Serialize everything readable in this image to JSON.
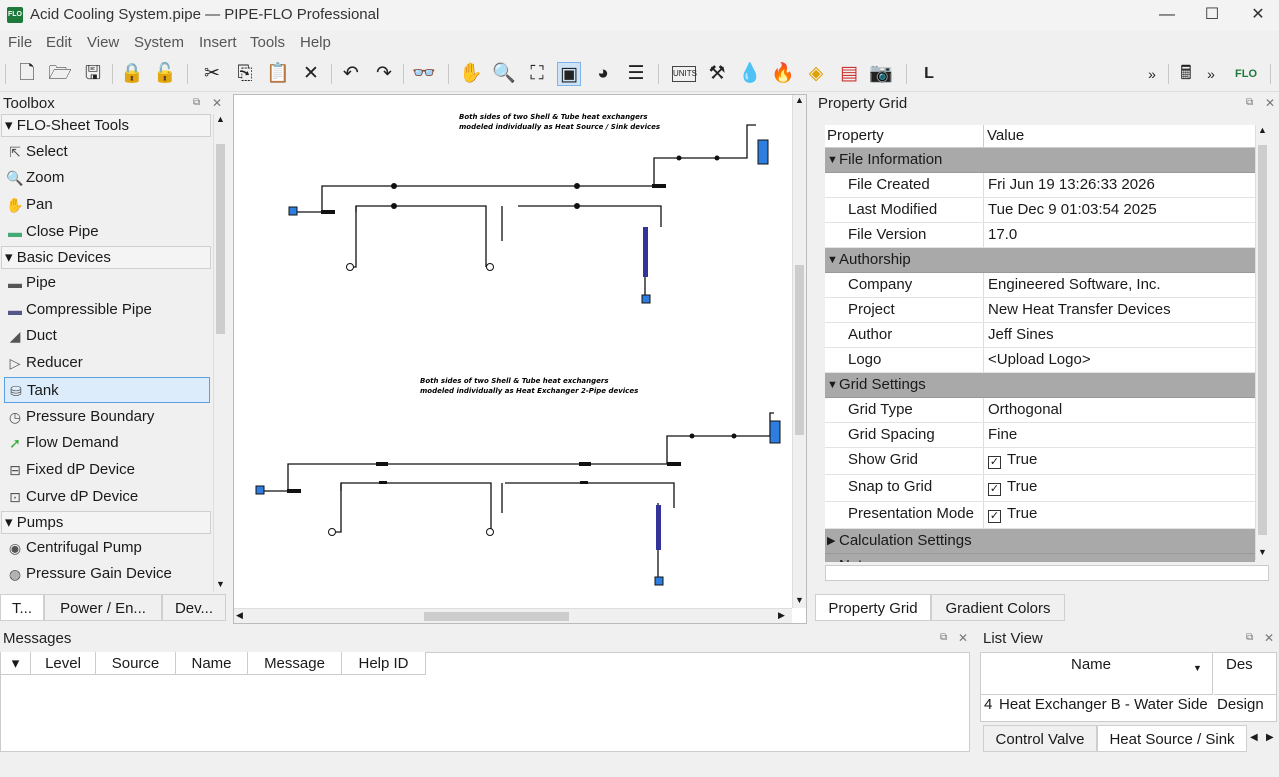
{
  "window": {
    "title": "Acid Cooling System.pipe — PIPE-FLO Professional",
    "logo_text": "FLO",
    "minimize": "—",
    "maximize": "☐",
    "close": "✕"
  },
  "menu": [
    "File",
    "Edit",
    "View",
    "System",
    "Insert",
    "Tools",
    "Help"
  ],
  "toolbar": {
    "overflow_1": "»",
    "overflow_2": "»",
    "units_label": "UNITS"
  },
  "toolbox": {
    "title": "Toolbox",
    "sections": {
      "flo_sheet": "FLO-Sheet Tools",
      "basic": "Basic Devices",
      "pumps": "Pumps"
    },
    "flo_sheet_items": [
      "Select",
      "Zoom",
      "Pan",
      "Close Pipe"
    ],
    "basic_items": [
      "Pipe",
      "Compressible Pipe",
      "Duct",
      "Reducer",
      "Tank",
      "Pressure Boundary",
      "Flow Demand",
      "Fixed dP Device",
      "Curve dP Device"
    ],
    "pump_items": [
      "Centrifugal Pump",
      "Pressure Gain Device"
    ],
    "tabs": [
      "T...",
      "Power / En...",
      "Dev..."
    ]
  },
  "canvas": {
    "note1_line1": "Both sides of two Shell & Tube heat exchangers",
    "note1_line2": "modeled individually as Heat Source / Sink devices",
    "note2_line1": "Both sides of two Shell & Tube heat exchangers",
    "note2_line2": "modeled individually as Heat Exchanger 2-Pipe devices"
  },
  "property_grid": {
    "title": "Property Grid",
    "col_property": "Property",
    "col_value": "Value",
    "categories": {
      "file_info": "File Information",
      "authorship": "Authorship",
      "grid_settings": "Grid Settings",
      "calc_settings": "Calculation Settings",
      "notes": "Notes"
    },
    "file_info": [
      {
        "k": "File Created",
        "v": "Fri Jun 19 13:26:33 2026"
      },
      {
        "k": "Last Modified",
        "v": "Tue Dec  9 01:03:54 2025"
      },
      {
        "k": "File Version",
        "v": "17.0"
      }
    ],
    "authorship": [
      {
        "k": "Company",
        "v": "Engineered Software, Inc."
      },
      {
        "k": "Project",
        "v": "New Heat Transfer Devices"
      },
      {
        "k": "Author",
        "v": "Jeff Sines"
      },
      {
        "k": "Logo",
        "v": "<Upload Logo>"
      }
    ],
    "grid_settings": [
      {
        "k": "Grid Type",
        "v": "Orthogonal"
      },
      {
        "k": "Grid Spacing",
        "v": "Fine"
      }
    ],
    "grid_checks": [
      {
        "k": "Show Grid",
        "v": "True"
      },
      {
        "k": "Snap to Grid",
        "v": "True"
      },
      {
        "k": "Presentation Mode",
        "v": "True"
      }
    ],
    "check_mark": "✓",
    "tabs": [
      "Property Grid",
      "Gradient Colors"
    ]
  },
  "messages": {
    "title": "Messages",
    "columns": [
      "Level",
      "Source",
      "Name",
      "Message",
      "Help ID"
    ]
  },
  "list_view": {
    "title": "List View",
    "col_name": "Name",
    "col_desc": "Des",
    "row_index": "4",
    "row_name": "Heat Exchanger B - Water Side",
    "row_desc": "Design",
    "tabs": [
      "Control Valve",
      "Heat Source / Sink"
    ]
  }
}
